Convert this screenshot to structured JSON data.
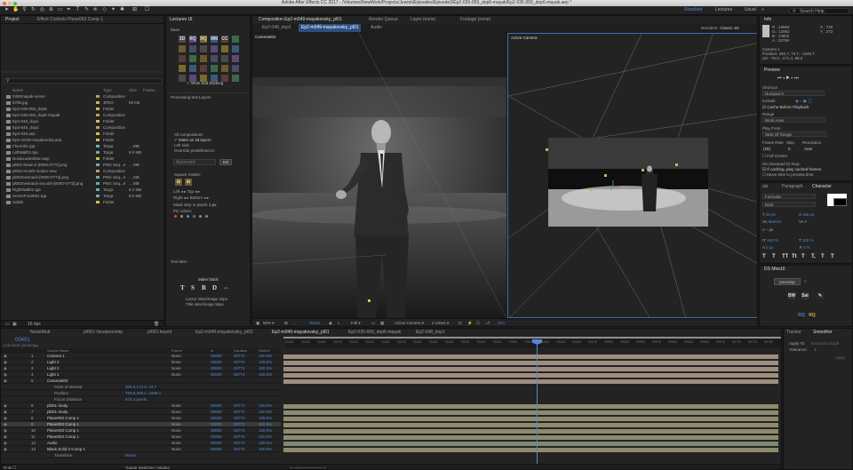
{
  "titlebar": {
    "text": "Adobe After Effects CC 2017 - /Volumes/NewWork/Projects/Jewish/Episodes/Episode3/Ep2-035-059_dop6-mayak/Ep2-035-059_dop6-mayak.aep *"
  },
  "workspaces": {
    "standard": "Standard",
    "lectures": "Lectures",
    "usual": "Usual",
    "search": "Search Help"
  },
  "project": {
    "tab1": "Project",
    "tab2": "Effect Controls Plane003 Comp 1",
    "cols": {
      "name": "Name",
      "type": "Type",
      "size": "Size",
      "frame": "Frame ..."
    },
    "items": [
      {
        "name": "0490mayak-scene",
        "type": "Composition",
        "size": "",
        "color": "#b8a06a"
      },
      {
        "name": "5796.jpg",
        "type": "JPEG",
        "size": "93 KB",
        "color": "#b7b76e"
      },
      {
        "name": "Ep2-035-059_dop6",
        "type": "Folder",
        "size": "",
        "color": "#c9c24a"
      },
      {
        "name": "Ep2-035-059_dop6-mayak",
        "type": "Composition",
        "size": "",
        "color": "#b8a06a"
      },
      {
        "name": "Ep2-048_dop1",
        "type": "Folder",
        "size": "",
        "color": "#c9c24a"
      },
      {
        "name": "Ep2-048_dop2",
        "type": "Composition",
        "size": "",
        "color": "#b8a06a"
      },
      {
        "name": "Ep2-048.aep",
        "type": "Folder",
        "size": "",
        "color": "#c9c24a"
      },
      {
        "name": "Ep2-m049-mayakovsky.aep",
        "type": "Folder",
        "size": "",
        "color": "#c9c24a"
      },
      {
        "name": "Floor001.tga",
        "type": "Targa",
        "size": "... MB",
        "color": "#6ab0a8"
      },
      {
        "name": "LeftWall01.tga",
        "type": "Targa",
        "size": "9.0 MB",
        "color": "#6ab0a8"
      },
      {
        "name": "NoiseLaeEdition.aep",
        "type": "Folder",
        "size": "",
        "color": "#c9c24a"
      },
      {
        "name": "pl001-head-cl-[0000-0773].png",
        "type": "PNG Seq...e",
        "size": "... MB",
        "color": "#6ab0a8"
      },
      {
        "name": "pl002-mouth-motion-new",
        "type": "Composition",
        "size": "",
        "color": "#b8a06a"
      },
      {
        "name": "pl002newnack-[0000-0773].png",
        "type": "PNG Seq...e",
        "size": "... MB",
        "color": "#6ab0a8"
      },
      {
        "name": "pl002newnack-smooth-[0000-0773].png",
        "type": "PNG Seq...e",
        "size": "... MB",
        "color": "#6ab0a8"
      },
      {
        "name": "RightWall01.tga",
        "type": "Targa",
        "size": "8.1 MB",
        "color": "#6ab0a8"
      },
      {
        "name": "SceneFront001.tga",
        "type": "Targa",
        "size": "9.0 MB",
        "color": "#6ab0a8"
      },
      {
        "name": "Solids",
        "type": "Folder",
        "size": "",
        "color": "#c9c24a"
      }
    ],
    "footer": "16 bpc"
  },
  "lectures": {
    "tab": "Lectures UI",
    "base": "Base",
    "work_bad": "Work bad tracking",
    "processing": "Processing text Layers",
    "opt1": "All compositions",
    "opt2": "Make as 3d layers",
    "opt3": "Left side",
    "opt4": "Override predefined to:",
    "automatic": "Automatic",
    "del": "Del",
    "square": "Square masks:",
    "left": "Left",
    "top": "Top",
    "right": "Right",
    "bottom": "Bottom",
    "mask_step": "Mask step in pixels:",
    "mask_val": "1 px",
    "pin": "Pin colors:",
    "textmisc": "Text Misc",
    "make_black": "Make black",
    "lector": "Lector inter/image 42px",
    "title_px": "Title inter/image 56px",
    "icons": [
      "3D",
      "RQ",
      "RQ",
      "MM",
      "CC"
    ]
  },
  "composition": {
    "tabs": [
      "Composition Ep2-m049-mayakovsky_pl01",
      "Render Queue",
      "Layer (none)",
      "Footage (none)"
    ],
    "subtabs": [
      "Ep2-048_dop1",
      "Ep2-m049-mayakovsky_pl01",
      "Audio"
    ],
    "renderer": "Renderer:",
    "renderer_val": "Classic 3D",
    "view_left": "Camera002",
    "view_right": "Active Camera",
    "footer": {
      "zoom": "50%",
      "time": "00401",
      "quality": "Full",
      "camera": "Active Camera",
      "views": "2 Views",
      "exposure": "+0.0"
    }
  },
  "info": {
    "tab": "Info",
    "r": "R : 13902",
    "g": "G : 13902",
    "b": "B : 13902",
    "a": "A : 32768",
    "x": "X : 730",
    "y": "Y : 373",
    "cam": "Camera 1",
    "pos": "Position: 450.7, 74.7, -1245.7",
    "delta": "ΔX: -75.0, -171.4, 99.2"
  },
  "preview": {
    "tab": "Preview",
    "shortcut": "Shortcut",
    "numpad": "Numpad 0",
    "include": "Include:",
    "cache": "Cache Before Playback",
    "range": "Range",
    "work_area": "Work Area",
    "play_from": "Play From",
    "start": "Start Of Range",
    "frame_rate": "Frame Rate",
    "skip": "Skip",
    "resolution": "Resolution",
    "fps": "(25)",
    "skip_val": "0",
    "res_val": "Auto",
    "fullscreen": "Full Screen",
    "stop_label": "On (Numpad 0) Stop:",
    "if_caching": "If caching, play cached frames",
    "move_time": "Move time to preview time"
  },
  "character": {
    "tab1": "als",
    "tab2": "Paragraph",
    "tab3": "Character",
    "font": "Formular",
    "style": "Bold",
    "size": "26 px",
    "leading": "155 px",
    "tracking": "0",
    "kerning": "Metrics",
    "unit": "px",
    "v_scale": "100 %",
    "h_scale": "100 %",
    "baseline": "0 px",
    "tsume": "0 %",
    "styles": [
      "T",
      "T",
      "TT",
      "Tt",
      "T",
      "T,",
      "T",
      "T"
    ]
  },
  "ds": {
    "tab": "DS MissUI",
    "precomp": "precomp",
    "bw": "BW",
    "sat": "Sat"
  },
  "timeline": {
    "tabs": [
      "NoiseMult",
      "pl001~faceprecomp",
      "pl001-keyed",
      "Ep2-m049-mayakovsky_pl02",
      "Ep2-m049-mayakovsky_pl01",
      "Ep2-035-059_dop6-mayak",
      "Ep2-048_dop1"
    ],
    "timecode": "00401",
    "timecode_sub": "0:00:16:01 (25.00 fps)",
    "cols": {
      "source": "Source Name",
      "parent": "Parent",
      "in": "In",
      "duration": "Duration",
      "stretch": "Stretch"
    },
    "layers": [
      {
        "num": "1",
        "name": "Camera 1",
        "in": "00000",
        "dur": "00774",
        "str": "100.0%",
        "parent": "None"
      },
      {
        "num": "2",
        "name": "Light 3",
        "in": "00000",
        "dur": "00774",
        "str": "100.0%",
        "parent": "None"
      },
      {
        "num": "3",
        "name": "Light 2",
        "in": "00000",
        "dur": "00774",
        "str": "100.0%",
        "parent": "None"
      },
      {
        "num": "4",
        "name": "Light 1",
        "in": "00000",
        "dur": "00774",
        "str": "100.0%",
        "parent": "None"
      },
      {
        "num": "5",
        "name": "Camera002",
        "in": "",
        "dur": "",
        "str": "",
        "parent": ""
      },
      {
        "num": "",
        "name": "Point of Interest",
        "in": "809.0,173.0,-34.7",
        "dur": "",
        "str": "",
        "parent": ""
      },
      {
        "num": "",
        "name": "Position",
        "in": "793.8,209.0,-1808.1",
        "dur": "",
        "str": "",
        "parent": ""
      },
      {
        "num": "",
        "name": "Focus Distance",
        "in": "873.4 pixels",
        "dur": "",
        "str": "",
        "parent": ""
      },
      {
        "num": "6",
        "name": "pl001~body",
        "in": "00000",
        "dur": "00774",
        "str": "100.0%",
        "parent": "None"
      },
      {
        "num": "7",
        "name": "pl001~body",
        "in": "00000",
        "dur": "00774",
        "str": "100.0%",
        "parent": "None"
      },
      {
        "num": "8",
        "name": "Plane002 Comp 1",
        "in": "00000",
        "dur": "00774",
        "str": "100.0%",
        "parent": "None"
      },
      {
        "num": "9",
        "name": "Plane003 Comp 1",
        "in": "00000",
        "dur": "00774",
        "str": "100.0%",
        "parent": "None"
      },
      {
        "num": "10",
        "name": "Plane003 Comp 1",
        "in": "00000",
        "dur": "00774",
        "str": "100.0%",
        "parent": "None"
      },
      {
        "num": "11",
        "name": "Plane004 Comp 1",
        "in": "00000",
        "dur": "00774",
        "str": "100.0%",
        "parent": "None"
      },
      {
        "num": "12",
        "name": "Audio",
        "in": "00000",
        "dur": "00774",
        "str": "100.0%",
        "parent": "None"
      },
      {
        "num": "13",
        "name": "Black Solid 2 Comp 1",
        "in": "00000",
        "dur": "00774",
        "str": "100.0%",
        "parent": "None"
      },
      {
        "num": "",
        "name": "Transform",
        "in": "Reset",
        "dur": "",
        "str": "",
        "parent": ""
      }
    ],
    "ruler": [
      "00000",
      "00025",
      "00050",
      "00075",
      "00100",
      "00125",
      "00150",
      "00175",
      "00200",
      "00225",
      "00250",
      "00275",
      "00300",
      "00325",
      "00350",
      "00375",
      "00400",
      "00425",
      "00450",
      "00475",
      "00500",
      "00525",
      "00550",
      "00575",
      "00600",
      "00625",
      "00650",
      "00675",
      "00700",
      "00725",
      "00750"
    ],
    "footer": "Toggle Switches / Modes"
  },
  "tracker": {
    "tab1": "Tracker",
    "tab2": "Smoother",
    "apply": "Apply To:",
    "apply_val": "Temporal Graph",
    "tolerance": "Tolerance:",
    "tol_val": "1",
    "apply_btn": "Apply"
  }
}
